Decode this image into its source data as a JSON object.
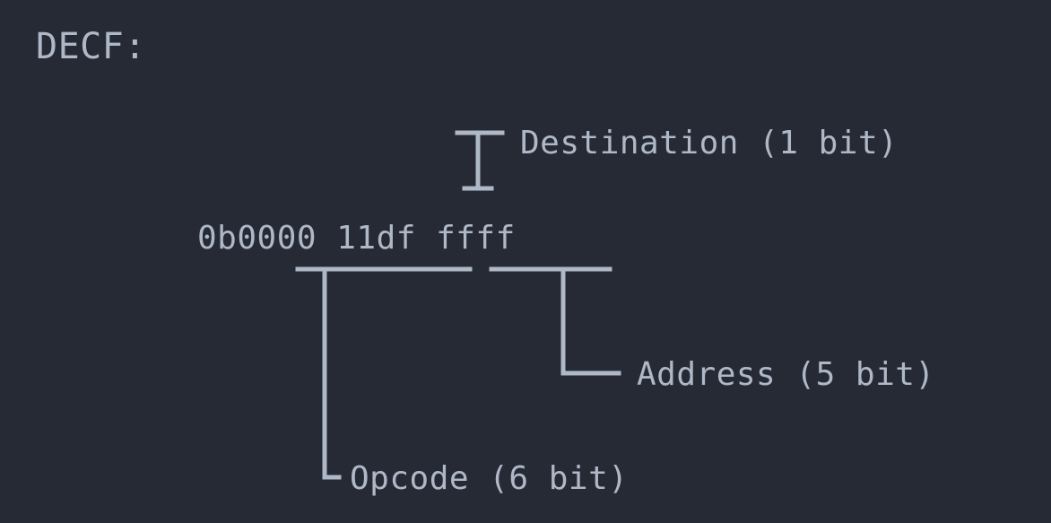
{
  "title": "DECF:",
  "encoding": "0b0000 11df ffff",
  "labels": {
    "destination": "Destination (1 bit)",
    "address": "Address (5 bit)",
    "opcode": "Opcode (6 bit)"
  },
  "line_color": "#aeb8c7"
}
